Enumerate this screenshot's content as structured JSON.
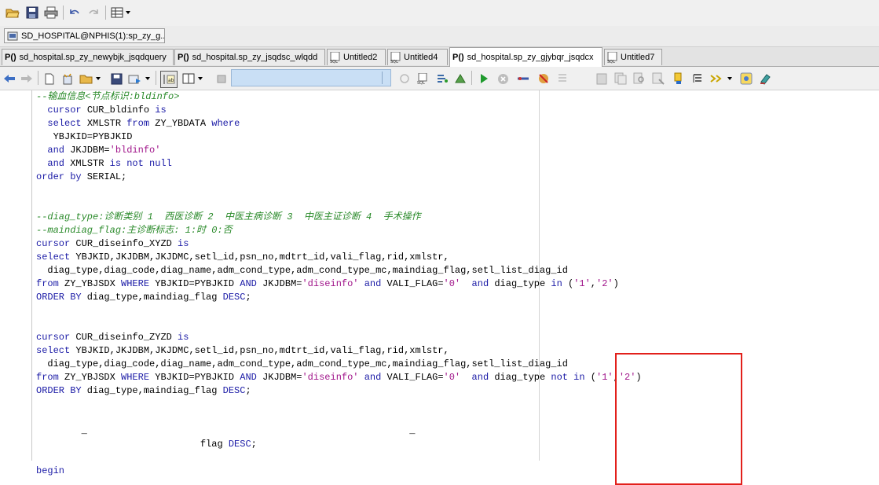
{
  "connection": {
    "label": "SD_HOSPITAL@NPHIS(1):sp_zy_g.."
  },
  "tabs": [
    {
      "icon": "P()",
      "label": "sd_hospital.sp_zy_newybjk_jsqdquery"
    },
    {
      "icon": "P()",
      "label": "sd_hospital.sp_zy_jsqdsc_wlqdd"
    },
    {
      "icon": "SQL",
      "label": "Untitled2"
    },
    {
      "icon": "SQL",
      "label": "Untitled4"
    },
    {
      "icon": "P()",
      "label": "sd_hospital.sp_zy_gjybqr_jsqdcx"
    },
    {
      "icon": "SQL",
      "label": "Untitled7"
    }
  ],
  "colors": {
    "keyword": "#1a1aa6",
    "comment": "#2a8a2a",
    "string": "#a0148a",
    "highlight_box": "#e2201b"
  },
  "code_lines": [
    [
      [
        "cm",
        "--输血信息<节点标识:bldinfo>"
      ]
    ],
    [
      [
        "",
        "  "
      ],
      [
        "kw",
        "cursor"
      ],
      [
        "",
        " CUR_bldinfo "
      ],
      [
        "kw",
        "is"
      ]
    ],
    [
      [
        "",
        "  "
      ],
      [
        "kw",
        "select"
      ],
      [
        "",
        " XMLSTR "
      ],
      [
        "kw",
        "from"
      ],
      [
        "",
        " ZY_YBDATA "
      ],
      [
        "kw",
        "where"
      ]
    ],
    [
      [
        "",
        "   YBJKID=PYBJKID"
      ]
    ],
    [
      [
        "",
        "  "
      ],
      [
        "kw",
        "and"
      ],
      [
        "",
        " JKJDBM="
      ],
      [
        "st",
        "'bldinfo'"
      ]
    ],
    [
      [
        "",
        "  "
      ],
      [
        "kw",
        "and"
      ],
      [
        "",
        " XMLSTR "
      ],
      [
        "kw",
        "is not null"
      ]
    ],
    [
      [
        "kw",
        "order by"
      ],
      [
        "",
        " SERIAL;"
      ]
    ],
    [
      [
        "",
        ""
      ]
    ],
    [
      [
        "",
        ""
      ]
    ],
    [
      [
        "cm",
        "--diag_type:诊断类别 1  西医诊断 2  中医主病诊断 3  中医主证诊断 4  手术操作"
      ]
    ],
    [
      [
        "cm",
        "--maindiag_flag:主诊断标志: 1:时 0:否"
      ]
    ],
    [
      [
        "kw",
        "cursor"
      ],
      [
        "",
        " CUR_diseinfo_XYZD "
      ],
      [
        "kw",
        "is"
      ]
    ],
    [
      [
        "kw",
        "select"
      ],
      [
        "",
        " YBJKID,JKJDBM,JKJDMC,setl_id,psn_no,mdtrt_id,vali_flag,rid,xmlstr,"
      ]
    ],
    [
      [
        "",
        "  diag_type,diag_code,diag_name,adm_cond_type,adm_cond_type_mc,maindiag_flag,setl_list_diag_id"
      ]
    ],
    [
      [
        "kw",
        "from"
      ],
      [
        "",
        " ZY_YBJSDX "
      ],
      [
        "kw",
        "WHERE"
      ],
      [
        "",
        " YBJKID=PYBJKID "
      ],
      [
        "kw",
        "AND"
      ],
      [
        "",
        " JKJDBM="
      ],
      [
        "st",
        "'diseinfo'"
      ],
      [
        "",
        ""
      ],
      [
        "kw",
        " and"
      ],
      [
        "",
        " VALI_FLAG="
      ],
      [
        "st",
        "'0'"
      ],
      [
        "",
        "  "
      ],
      [
        "kw",
        "and"
      ],
      [
        "",
        " diag_type "
      ],
      [
        "kw",
        "in"
      ],
      [
        "",
        " ("
      ],
      [
        "st",
        "'1'"
      ],
      [
        "",
        ","
      ],
      [
        "st",
        "'2'"
      ],
      [
        "",
        ")"
      ]
    ],
    [
      [
        "kw",
        "ORDER BY"
      ],
      [
        "",
        " diag_type,maindiag_flag "
      ],
      [
        "kw",
        "DESC"
      ],
      [
        "",
        ";"
      ]
    ],
    [
      [
        "",
        ""
      ]
    ],
    [
      [
        "",
        ""
      ]
    ],
    [
      [
        "kw",
        "cursor"
      ],
      [
        "",
        " CUR_diseinfo_ZYZD "
      ],
      [
        "kw",
        "is"
      ]
    ],
    [
      [
        "kw",
        "select"
      ],
      [
        "",
        " YBJKID,JKJDBM,JKJDMC,setl_id,psn_no,mdtrt_id,vali_flag,rid,xmlstr,"
      ]
    ],
    [
      [
        "",
        "  diag_type,diag_code,diag_name,adm_cond_type,adm_cond_type_mc,maindiag_flag,setl_list_diag_id"
      ]
    ],
    [
      [
        "kw",
        "from"
      ],
      [
        "",
        " ZY_YBJSDX "
      ],
      [
        "kw",
        "WHERE"
      ],
      [
        "",
        " YBJKID=PYBJKID "
      ],
      [
        "kw",
        "AND"
      ],
      [
        "",
        " JKJDBM="
      ],
      [
        "st",
        "'diseinfo'"
      ],
      [
        "kw",
        " and"
      ],
      [
        "",
        " VALI_FLAG="
      ],
      [
        "st",
        "'0'"
      ],
      [
        "",
        "  "
      ],
      [
        "kw",
        "and"
      ],
      [
        "",
        " diag_type "
      ],
      [
        "kw",
        "not in"
      ],
      [
        "",
        " ("
      ],
      [
        "st",
        "'1'"
      ],
      [
        "",
        ","
      ],
      [
        "st",
        "'2'"
      ],
      [
        "",
        ")"
      ]
    ],
    [
      [
        "kw",
        "ORDER BY"
      ],
      [
        "",
        " diag_type,maindiag_flag "
      ],
      [
        "kw",
        "DESC"
      ],
      [
        "",
        ";"
      ]
    ],
    [
      [
        "",
        ""
      ]
    ],
    [
      [
        "",
        ""
      ]
    ],
    [
      [
        "",
        "        _                                                         _"
      ]
    ],
    [
      [
        "",
        "                             flag "
      ],
      [
        "kw",
        "DESC"
      ],
      [
        "",
        ";"
      ]
    ],
    [
      [
        "",
        ""
      ]
    ],
    [
      [
        "kw",
        "begin"
      ]
    ]
  ]
}
